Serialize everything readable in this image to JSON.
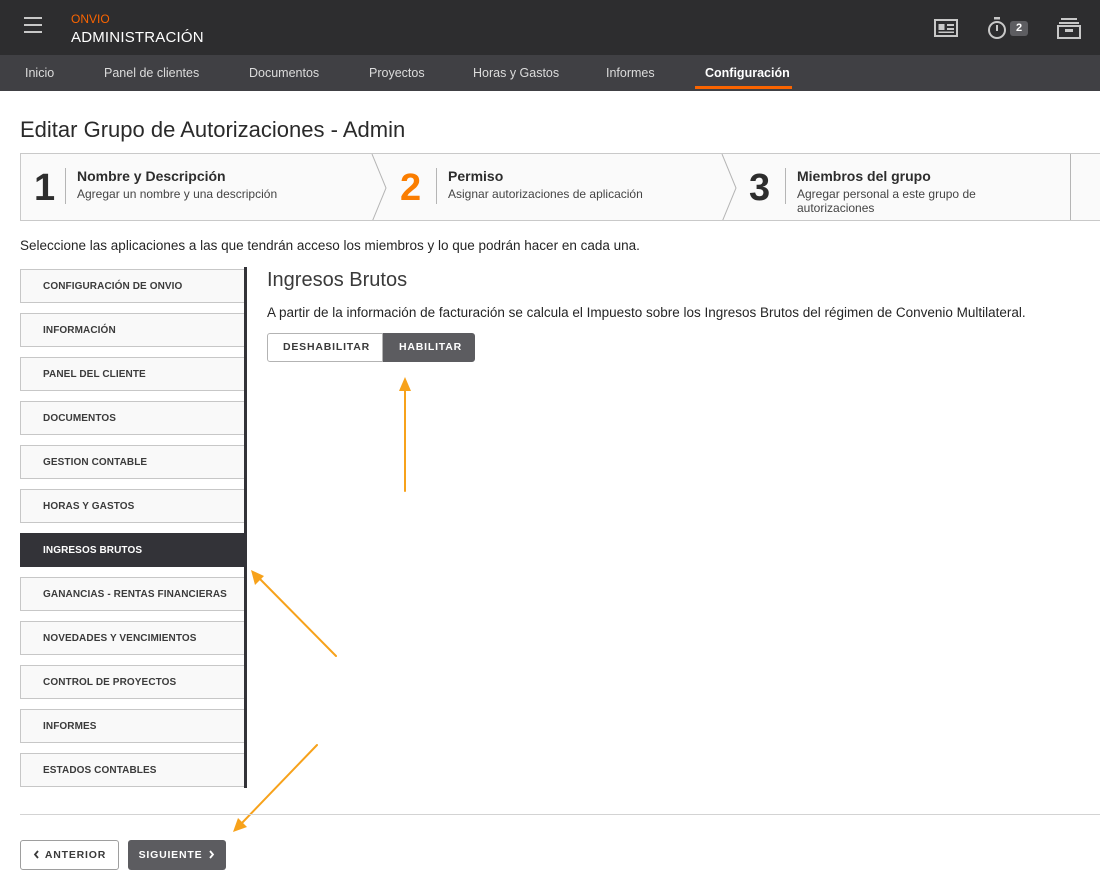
{
  "header": {
    "brand": "ONVIO",
    "app_title": "ADMINISTRACIÓN",
    "timer_badge": "2",
    "accent_color": "#fa6400",
    "icons": [
      "menu-icon",
      "contact-card-icon",
      "stopwatch-icon",
      "inbox-archive-icon"
    ]
  },
  "nav": {
    "items": [
      {
        "label": "Inicio"
      },
      {
        "label": "Panel de clientes"
      },
      {
        "label": "Documentos"
      },
      {
        "label": "Proyectos"
      },
      {
        "label": "Horas y Gastos"
      },
      {
        "label": "Informes"
      },
      {
        "label": "Configuración"
      }
    ],
    "active": "Configuración"
  },
  "page": {
    "title": "Editar Grupo de Autorizaciones - Admin",
    "instruction": "Seleccione las aplicaciones a las que tendrán acceso los miembros y lo que podrán hacer en cada una."
  },
  "wizard": {
    "steps": [
      {
        "number": "1",
        "title": "Nombre y Descripción",
        "desc": "Agregar un nombre y una descripción"
      },
      {
        "number": "2",
        "title": "Permiso",
        "desc": "Asignar autorizaciones de aplicación"
      },
      {
        "number": "3",
        "title": "Miembros del grupo",
        "desc": "Agregar personal a este grupo de autorizaciones"
      }
    ],
    "active_step": "2"
  },
  "apps": {
    "items": [
      {
        "label": "CONFIGURACIÓN DE ONVIO"
      },
      {
        "label": "INFORMACIÓN"
      },
      {
        "label": "PANEL DEL CLIENTE"
      },
      {
        "label": "DOCUMENTOS"
      },
      {
        "label": "GESTION CONTABLE"
      },
      {
        "label": "HORAS Y GASTOS"
      },
      {
        "label": "INGRESOS BRUTOS"
      },
      {
        "label": "GANANCIAS - RENTAS FINANCIERAS"
      },
      {
        "label": "NOVEDADES Y VENCIMIENTOS"
      },
      {
        "label": "CONTROL DE PROYECTOS"
      },
      {
        "label": "INFORMES"
      },
      {
        "label": "ESTADOS CONTABLES"
      }
    ],
    "active": "INGRESOS BRUTOS"
  },
  "detail": {
    "title": "Ingresos Brutos",
    "description": "A partir de la información de facturación se calcula el Impuesto sobre los Ingresos Brutos del régimen de Convenio Multilateral.",
    "disable_label": "DESHABILITAR",
    "enable_label": "HABILITAR",
    "selected": "HABILITAR"
  },
  "footer": {
    "prev_label": "ANTERIOR",
    "next_label": "SIGUIENTE"
  },
  "annotation_color": "#f7a21b"
}
